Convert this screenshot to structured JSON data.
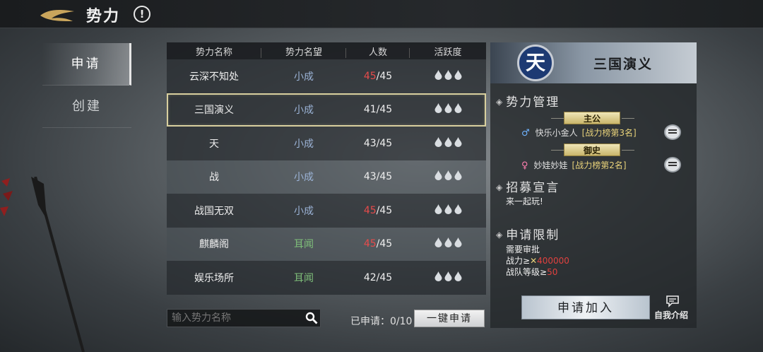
{
  "header": {
    "title": "势力",
    "info_symbol": "!"
  },
  "sidebar": {
    "tabs": [
      {
        "label": "申请",
        "active": true
      },
      {
        "label": "创建",
        "active": false
      }
    ]
  },
  "table": {
    "columns": [
      "势力名称",
      "势力名望",
      "人数",
      "活跃度"
    ],
    "rows": [
      {
        "name": "云深不知处",
        "reputation": "小成",
        "count_current": "45",
        "count_max": "/45",
        "full": true
      },
      {
        "name": "三国演义",
        "reputation": "小成",
        "count_current": "41",
        "count_max": "/45",
        "full": false,
        "selected": true
      },
      {
        "name": "天",
        "reputation": "小成",
        "count_current": "43",
        "count_max": "/45",
        "full": false
      },
      {
        "name": "战",
        "reputation": "小成",
        "count_current": "43",
        "count_max": "/45",
        "full": false
      },
      {
        "name": "战国无双",
        "reputation": "小成",
        "count_current": "45",
        "count_max": "/45",
        "full": true
      },
      {
        "name": "麒麟阁",
        "reputation": "耳闻",
        "count_current": "45",
        "count_max": "/45",
        "full": true
      },
      {
        "name": "娱乐场所",
        "reputation": "耳闻",
        "count_current": "42",
        "count_max": "/45",
        "full": false
      }
    ],
    "activity_icon": "water-drop-icon",
    "activity_level": 3
  },
  "search": {
    "placeholder": "输入势力名称"
  },
  "applied": {
    "label": "已申请：0/10"
  },
  "one_key_apply": "一键申请",
  "detail": {
    "emblem": "天",
    "faction_name": "三国演义",
    "management_title": "势力管理",
    "leader_role": "主公",
    "leader_name": "快乐小金人",
    "leader_rank": "[战力榜第3名]",
    "vice_role": "御史",
    "vice_name": "妙娃妙娃",
    "vice_rank": "[战力榜第2名]",
    "recruit_title": "招募宣言",
    "recruit_text": "来一起玩!",
    "limit_title": "申请限制",
    "limit_approval": "需要审批",
    "limit_power_label": "战力≥",
    "limit_power_value": "400000",
    "limit_level_label": "战队等级≥",
    "limit_level_value": "50",
    "join_button": "申请加入",
    "intro_label": "自我介绍"
  },
  "colors": {
    "full_count": "#e74b4b",
    "rep_xiaocheng": "#9bb3d6",
    "rep_erwen": "#7fbf7a",
    "rank_gold": "#e8d27a"
  }
}
